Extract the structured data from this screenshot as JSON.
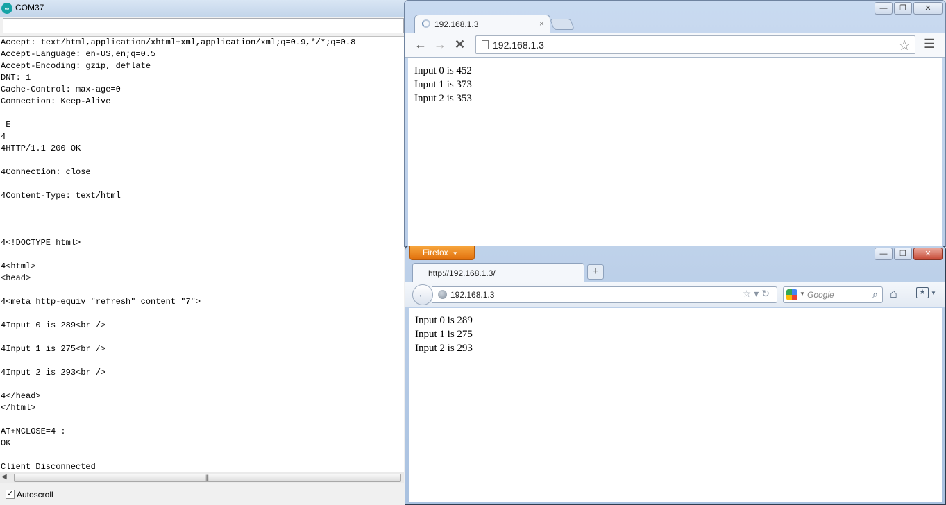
{
  "serial_monitor": {
    "title": "COM37",
    "app_icon": "arduino-icon",
    "send_input_value": "",
    "output_lines": [
      "Accept: text/html,application/xhtml+xml,application/xml;q=0.9,*/*;q=0.8",
      "Accept-Language: en-US,en;q=0.5",
      "Accept-Encoding: gzip, deflate",
      "DNT: 1",
      "Cache-Control: max-age=0",
      "Connection: Keep-Alive",
      "",
      " E",
      "4",
      "4HTTP/1.1 200 OK",
      "",
      "4Connection: close",
      "",
      "4Content-Type: text/html",
      "",
      "",
      "",
      "4<!DOCTYPE html>",
      "",
      "4<html>",
      "<head>",
      "",
      "4<meta http-equiv=\"refresh\" content=\"7\">",
      "",
      "4Input 0 is 289<br />",
      "",
      "4Input 1 is 275<br />",
      "",
      "4Input 2 is 293<br />",
      "",
      "4</head>",
      "</html>",
      "",
      "AT+NCLOSE=4 :",
      "OK",
      "",
      "Client Disconnected"
    ],
    "autoscroll_label": "Autoscroll",
    "autoscroll_checked": true
  },
  "chrome": {
    "tab_title": "192.168.1.3",
    "url": "192.168.1.3",
    "page_lines": [
      "Input 0 is 452",
      "Input 1 is 373",
      "Input 2 is 353"
    ]
  },
  "firefox": {
    "menu_button_label": "Firefox",
    "tab_title": "http://192.168.1.3/",
    "url": "192.168.1.3",
    "search_placeholder": "Google",
    "page_lines": [
      "Input 0 is 289",
      "Input 1 is 275",
      "Input 2 is 293"
    ]
  }
}
